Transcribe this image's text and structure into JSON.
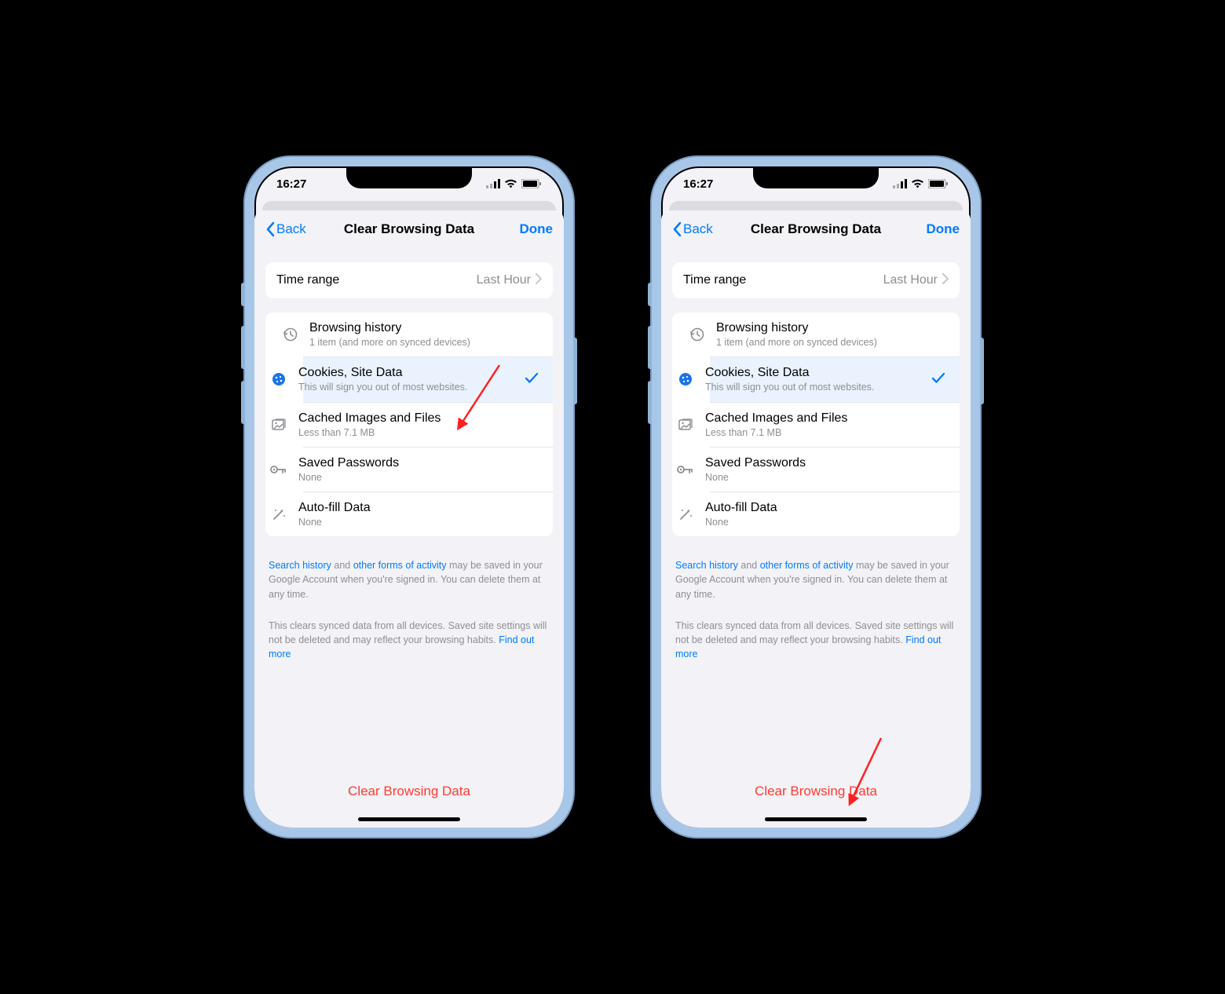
{
  "status": {
    "time": "16:27"
  },
  "nav": {
    "back": "Back",
    "title": "Clear Browsing Data",
    "done": "Done"
  },
  "timeRange": {
    "label": "Time range",
    "value": "Last Hour"
  },
  "items": {
    "history": {
      "title": "Browsing history",
      "sub": "1 item (and more on synced devices)"
    },
    "cookies": {
      "title": "Cookies, Site Data",
      "sub": "This will sign you out of most websites."
    },
    "cache": {
      "title": "Cached Images and Files",
      "sub": "Less than 7.1 MB"
    },
    "passwords": {
      "title": "Saved Passwords",
      "sub": "None"
    },
    "autofill": {
      "title": "Auto-fill Data",
      "sub": "None"
    }
  },
  "foot": {
    "link1": "Search history",
    "mid1": " and ",
    "link2": "other forms of activity",
    "tail1": " may be saved in your Google Account when you're signed in. You can delete them at any time.",
    "p2a": "This clears synced data from all devices. Saved site settings will not be deleted and may reflect your browsing habits. ",
    "link3": "Find out more"
  },
  "clearLabel": "Clear Browsing Data"
}
